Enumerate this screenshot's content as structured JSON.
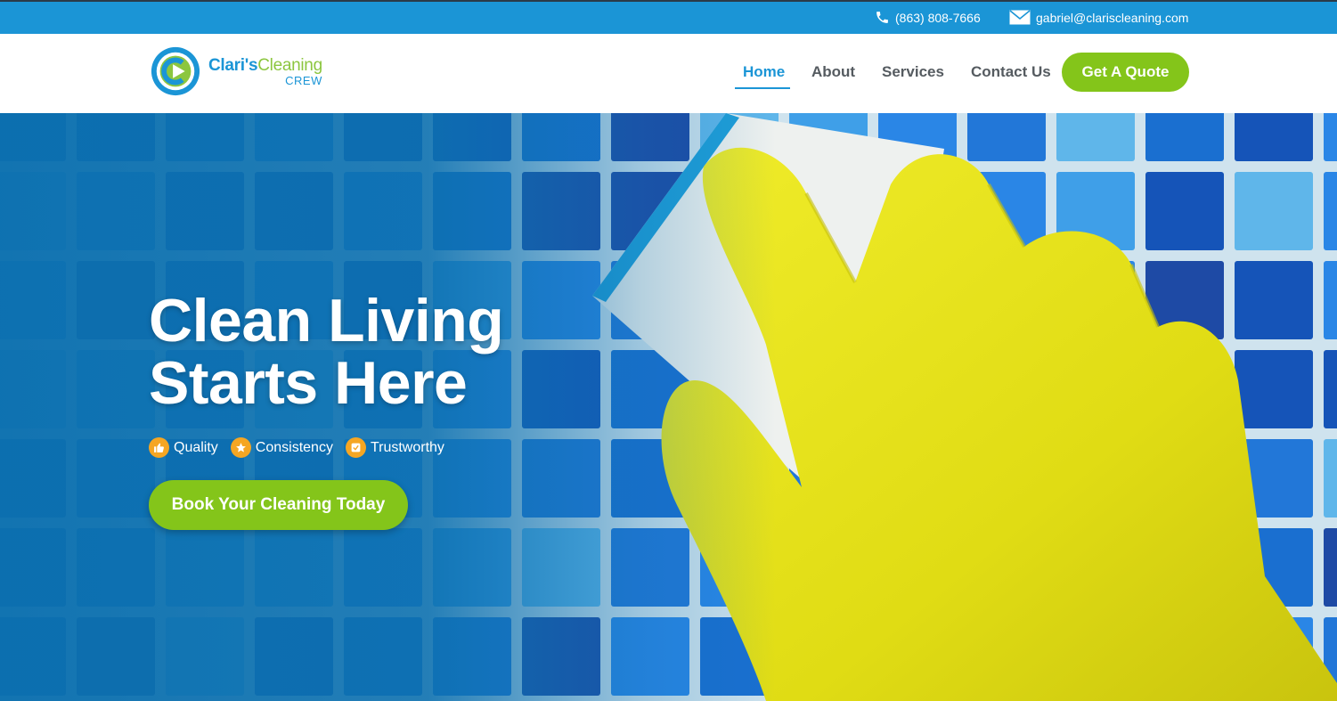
{
  "topbar": {
    "phone": "(863) 808-7666",
    "email": "gabriel@clarisclean­ing.com"
  },
  "logo": {
    "name_part1": "Clari's",
    "name_part2": "Cleaning",
    "tagline": "CREW"
  },
  "nav": {
    "items": [
      {
        "label": "Home",
        "active": true
      },
      {
        "label": "About",
        "active": false
      },
      {
        "label": "Services",
        "active": false
      },
      {
        "label": "Contact Us",
        "active": false
      }
    ],
    "cta_label": "Get A Quote"
  },
  "hero": {
    "title_line1": "Clean Living",
    "title_line2": "Starts Here",
    "badges": [
      {
        "icon": "thumbs-up-icon",
        "label": "Quality"
      },
      {
        "icon": "star-icon",
        "label": "Consistency"
      },
      {
        "icon": "check-icon",
        "label": "Trustworthy"
      }
    ],
    "cta_label": "Book Your Cleaning Today"
  },
  "colors": {
    "brand_blue": "#1b95d6",
    "brand_green": "#84c51a",
    "badge_orange": "#f5a623",
    "glove_yellow": "#e4e21a"
  }
}
